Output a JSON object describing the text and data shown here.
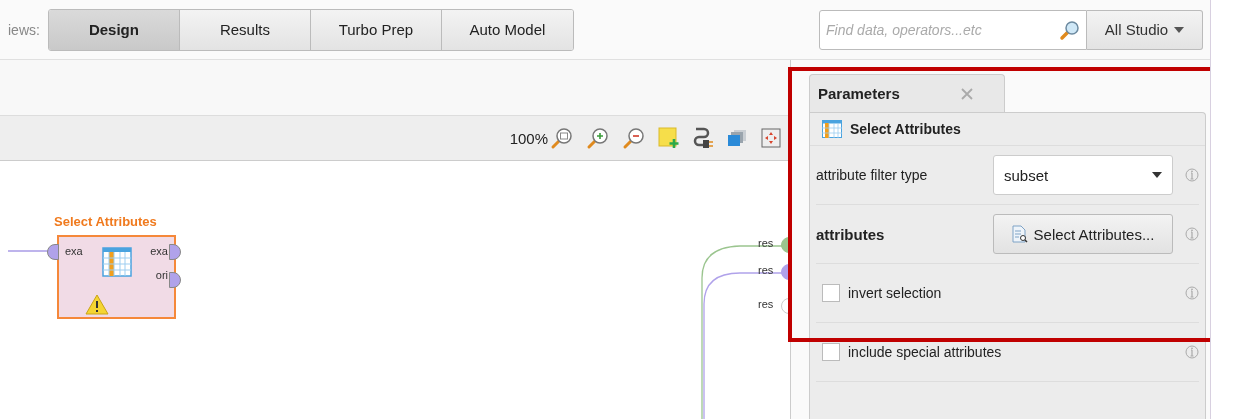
{
  "views": {
    "label": "iews:",
    "tabs": [
      {
        "label": "Design",
        "selected": true
      },
      {
        "label": "Results",
        "selected": false
      },
      {
        "label": "Turbo Prep",
        "selected": false
      },
      {
        "label": "Auto Model",
        "selected": false
      }
    ]
  },
  "search": {
    "placeholder": "Find data, operators...etc",
    "scope": "All Studio"
  },
  "zoom_level": "100%",
  "operator": {
    "title": "Select Attributes",
    "inputs": [
      "exa"
    ],
    "outputs": [
      "exa",
      "ori"
    ],
    "warning": true
  },
  "result_ports": [
    {
      "label": "res",
      "connected": true,
      "color": "#9bc58f"
    },
    {
      "label": "res",
      "connected": true,
      "color": "#b0a2ea"
    },
    {
      "label": "res",
      "connected": false,
      "color": "#cccccc"
    }
  ],
  "panel": {
    "tab": "Parameters",
    "operator": "Select Attributes",
    "params": [
      {
        "kind": "select",
        "label": "attribute filter type",
        "value": "subset"
      },
      {
        "kind": "button",
        "label": "attributes",
        "button": "Select Attributes..."
      },
      {
        "kind": "checkbox",
        "label": "invert selection",
        "checked": false
      },
      {
        "kind": "checkbox",
        "label": "include special attributes",
        "checked": false
      }
    ]
  }
}
